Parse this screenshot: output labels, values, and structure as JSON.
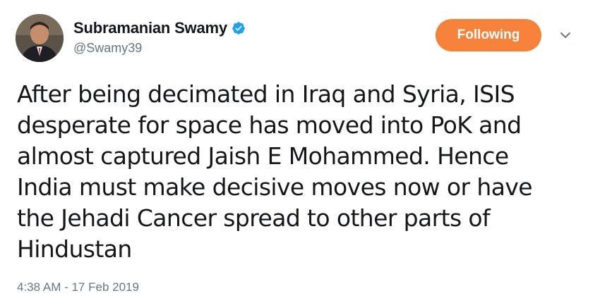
{
  "author": {
    "display_name": "Subramanian Swamy",
    "handle": "@Swamy39",
    "verified": true,
    "avatar_icon": "profile-photo"
  },
  "follow_button": {
    "label": "Following",
    "color": "#f5813a"
  },
  "menu": {
    "icon": "chevron-down-icon"
  },
  "tweet": {
    "text": "After being decimated in Iraq and Syria, ISIS\ndesperate for space has moved into PoK and\nalmost captured Jaish E Mohammed. Hence\nIndia must make decisive moves now or have\nthe Jehadi Cancer spread to other parts of\nHindustan",
    "timestamp": "4:38 AM - 17 Feb 2019"
  },
  "colors": {
    "verified_badge": "#1da1f2",
    "secondary_text": "#657786",
    "primary_text": "#14171a"
  }
}
